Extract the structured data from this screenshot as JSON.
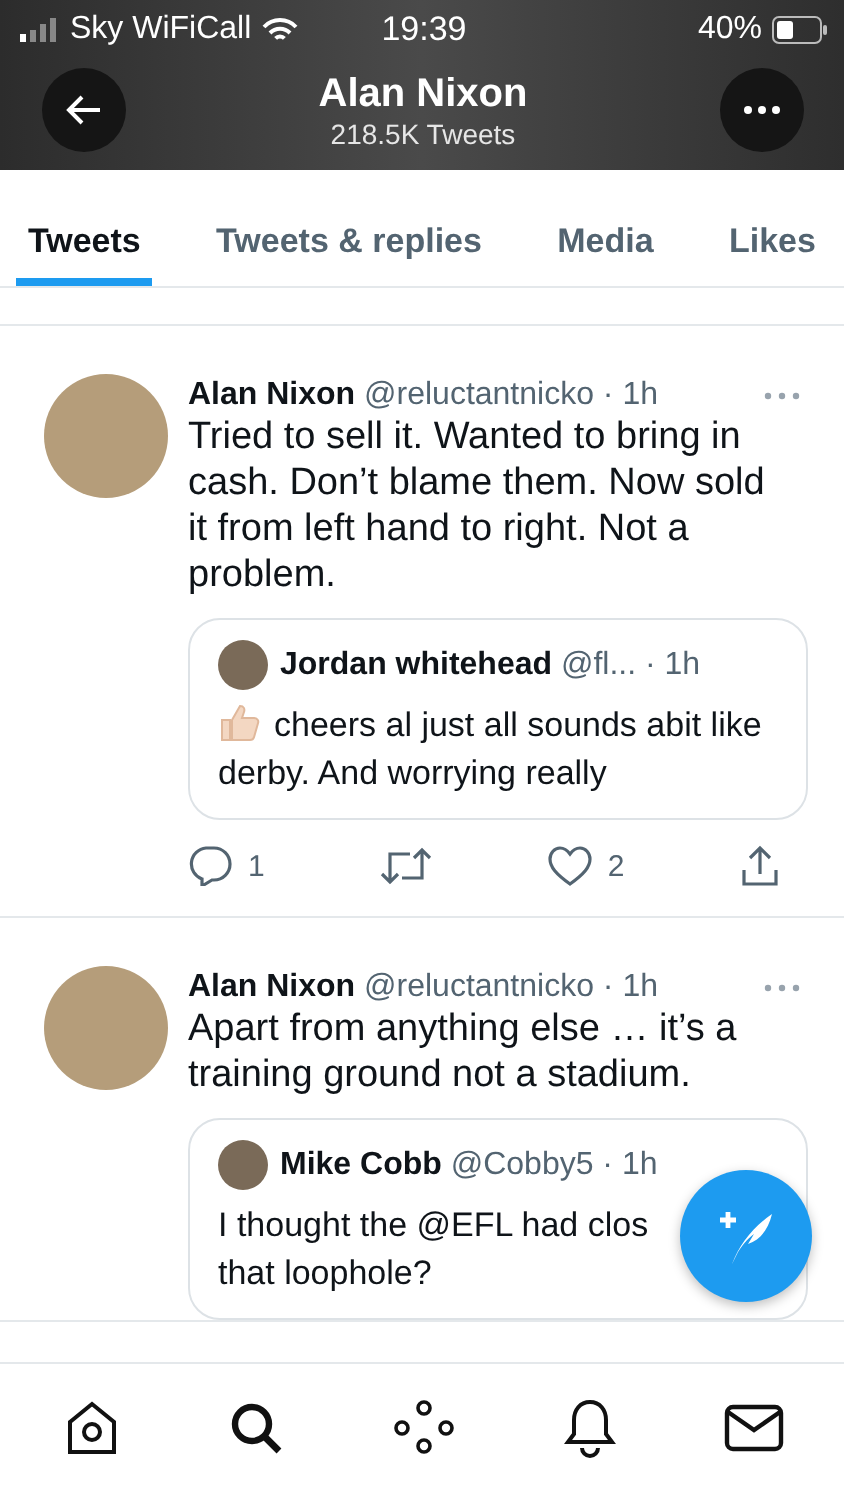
{
  "status_bar": {
    "carrier": "Sky WiFiCall",
    "time": "19:39",
    "battery": "40%"
  },
  "header": {
    "title": "Alan Nixon",
    "subtitle": "218.5K Tweets"
  },
  "tabs": [
    {
      "label": "Tweets",
      "selected": true
    },
    {
      "label": "Tweets & replies",
      "selected": false
    },
    {
      "label": "Media",
      "selected": false
    },
    {
      "label": "Likes",
      "selected": false
    }
  ],
  "tweets": [
    {
      "name": "Alan Nixon",
      "handle": "@reluctantnicko",
      "time": "· 1h",
      "text": "Tried to sell it. Wanted to bring in cash. Don’t blame them. Now sold it from left hand to right. Not a problem.",
      "quote": {
        "name": "Jordan whitehead",
        "handle": "@fl...",
        "time": "· 1h",
        "kind": "emoji",
        "text_lines": [
          "cheers al just all sounds abit like derby. And worrying really"
        ]
      },
      "actions": {
        "replies": "1",
        "likes": "2"
      }
    },
    {
      "name": "Alan Nixon",
      "handle": "@reluctantnicko",
      "time": "· 1h",
      "text": "Apart from anything else … it’s a training ground not a stadium.",
      "quote": {
        "name": "Mike Cobb",
        "handle": "@Cobby5",
        "time": "· 1h",
        "kind": "plain",
        "text_lines": [
          "I thought the @EFL had clos",
          "that loophole?"
        ]
      }
    }
  ]
}
